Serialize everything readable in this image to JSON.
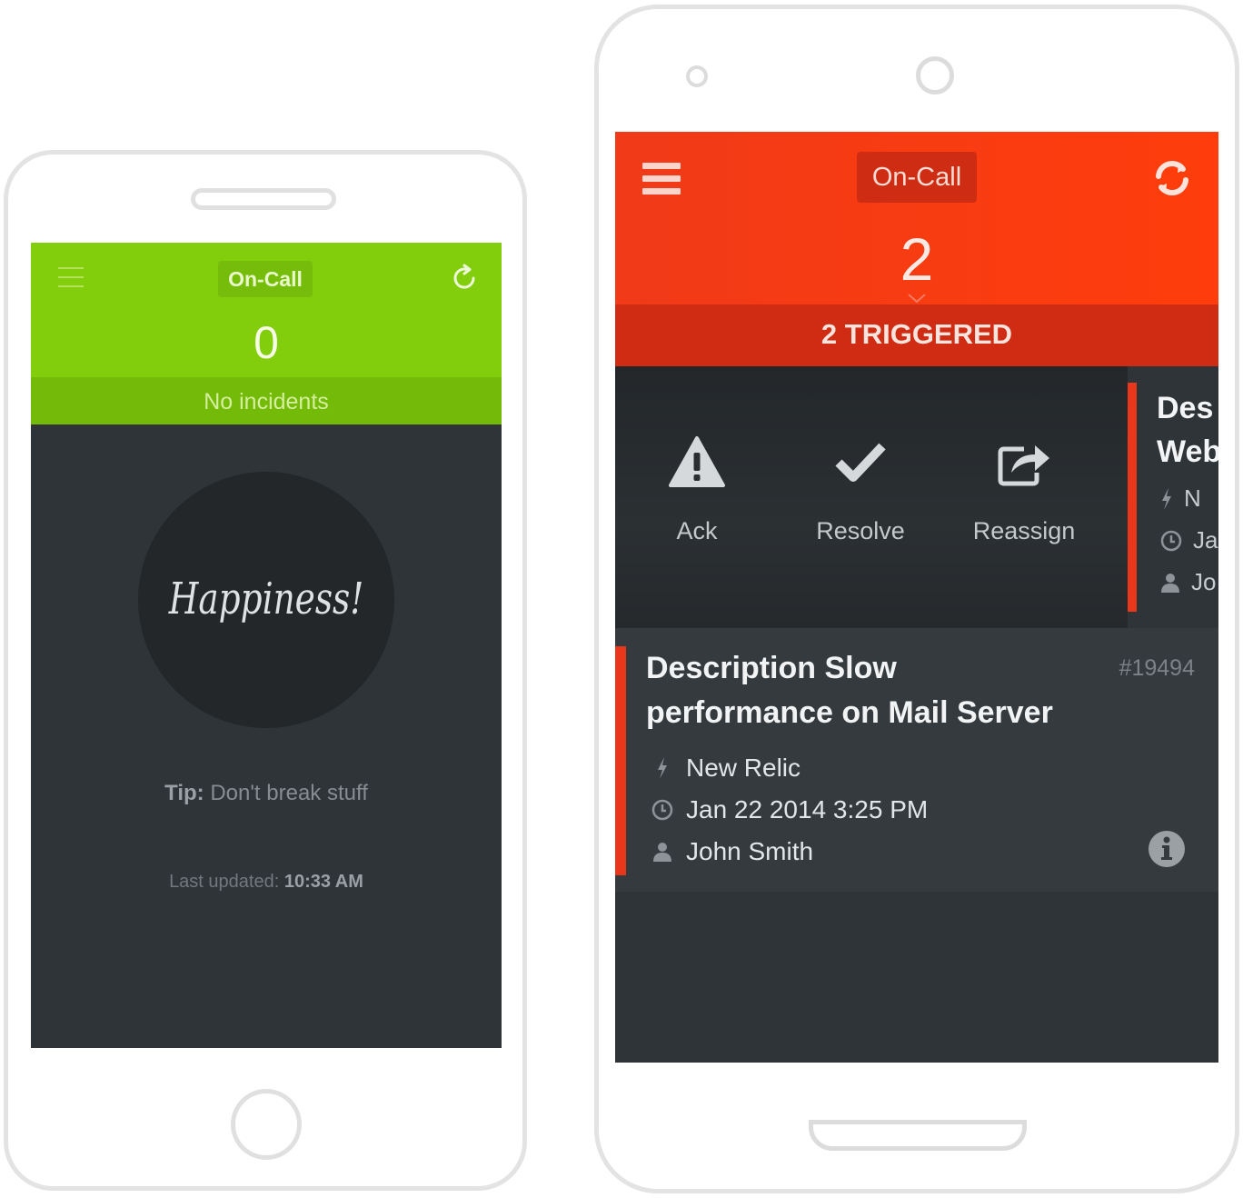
{
  "left_app": {
    "header": {
      "title": "On-Call",
      "count": "0",
      "status": "No incidents"
    },
    "body": {
      "badge_text": "Happiness!",
      "tip_label": "Tip:",
      "tip_text": "Don't break stuff",
      "updated_label": "Last updated:",
      "updated_time": "10:33 AM"
    },
    "colors": {
      "header": "#82cd0c",
      "status_bar": "#74ba08",
      "body": "#2f3438"
    },
    "icons": {
      "menu": "hamburger-icon",
      "refresh": "refresh-icon"
    }
  },
  "right_app": {
    "header": {
      "title": "On-Call",
      "count": "2",
      "status": "2 TRIGGERED"
    },
    "actions": [
      {
        "label": "Ack",
        "icon": "warning-icon"
      },
      {
        "label": "Resolve",
        "icon": "checkmark-icon"
      },
      {
        "label": "Reassign",
        "icon": "share-icon"
      }
    ],
    "peek_card": {
      "title_line1": "Des",
      "title_line2": "Web",
      "meta": [
        "N",
        "Ja",
        "Jo"
      ]
    },
    "incident": {
      "title": "Description Slow performance on Mail Server",
      "id": "#19494",
      "source": "New Relic",
      "time": "Jan 22 2014 3:25 PM",
      "assignee": "John Smith"
    },
    "colors": {
      "header": "#f03a18",
      "status_bar": "#cf2c13",
      "accent": "#e8371a",
      "body": "#2f3438"
    },
    "icons": {
      "menu": "hamburger-icon",
      "refresh": "sync-icon",
      "info": "info-icon"
    }
  }
}
